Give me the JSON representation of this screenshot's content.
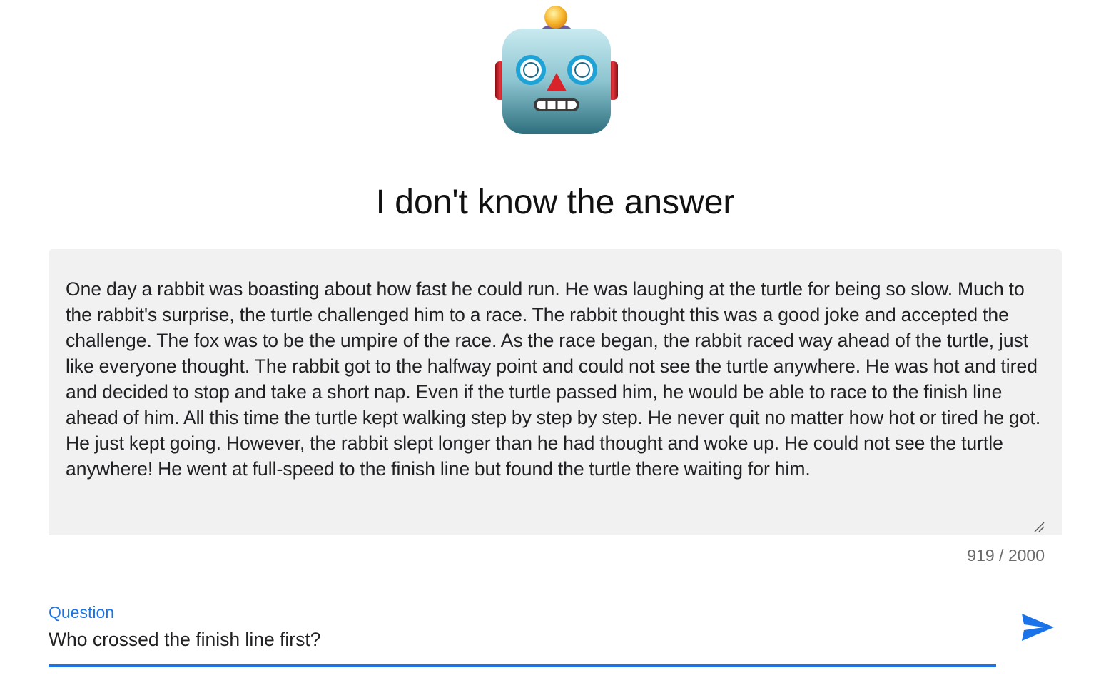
{
  "header": {
    "avatar_icon": "robot-face-icon",
    "answer_text": "I don't know the answer"
  },
  "context": {
    "text": "One day a rabbit was boasting about how fast he could run. He was laughing at the turtle for being so slow. Much to the rabbit's surprise, the turtle challenged him to a race. The rabbit thought this was a good joke and accepted the challenge. The fox was to be the umpire of the race. As the race began, the rabbit raced way ahead of the turtle, just like everyone thought. The rabbit got to the halfway point and could not see the turtle anywhere. He was hot and tired and decided to stop and take a short nap. Even if the turtle passed him, he would be able to race to the finish line ahead of him. All this time the turtle kept walking step by step by step. He never quit no matter how hot or tired he got. He just kept going. However, the rabbit slept longer than he had thought and woke up. He could not see the turtle anywhere! He went at full-speed to the finish line but found the turtle there waiting for him.",
    "char_count": "919 / 2000",
    "background_color": "#f1f1f1"
  },
  "question": {
    "label": "Question",
    "value": "Who crossed the finish line first?",
    "accent_color": "#1a73e8",
    "send_icon": "send-icon"
  }
}
